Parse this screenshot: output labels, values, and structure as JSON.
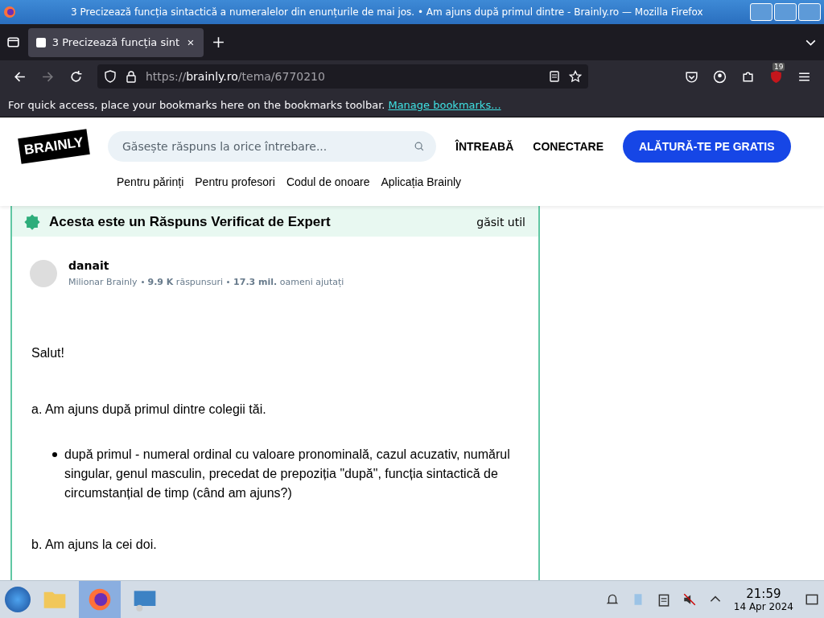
{
  "window": {
    "title": "3 Precizează funcția sintactică a numeralelor din enunțurile de mai jos. • Am ajuns după primul dintre - Brainly.ro — Mozilla Firefox"
  },
  "tabs": [
    {
      "label": "3 Precizează funcția sint",
      "selected": true
    }
  ],
  "address": {
    "scheme": "https://",
    "host": "brainly.ro",
    "path": "/tema/6770210"
  },
  "extension_badge": "19",
  "bookmarks_bar": {
    "text": "For quick access, place your bookmarks here on the bookmarks toolbar.",
    "link": "Manage bookmarks..."
  },
  "site": {
    "logo": "BRAINLY",
    "search": {
      "placeholder": "Găsește răspuns la orice întrebare..."
    },
    "nav": [
      "ÎNTREABĂ",
      "CONECTARE"
    ],
    "join": "ALĂTURĂ-TE PE GRATIS",
    "links": [
      "Pentru părinți",
      "Pentru profesori",
      "Codul de onoare",
      "Aplicația Brainly"
    ]
  },
  "answer": {
    "banner": "Acesta este un Răspuns Verificat de Expert",
    "found_useful": "găsit util",
    "author": {
      "name": "danait",
      "rank": "Milionar Brainly",
      "answers": "**9.9 K** răspunsuri",
      "helped": "**17.3 mil.** oameni ajutați"
    },
    "body": [
      {
        "kind": "paragraph",
        "text": "Salut!"
      },
      {
        "kind": "paragraph",
        "text": "a. Am ajuns după primul dintre colegii tăi."
      },
      {
        "kind": "bullet",
        "text": "după primul - numeral ordinal cu valoare pronominală, cazul acuzativ, numărul singular, genul masculin, precedat de prepoziția \"după\", funcția sintactică de circumstanțial de timp (când am ajuns?)"
      },
      {
        "kind": "paragraph",
        "text": "b. Am ajuns la cei doi."
      }
    ]
  },
  "taskbar": {
    "time": "21:59",
    "date": "14 Apr 2024"
  }
}
